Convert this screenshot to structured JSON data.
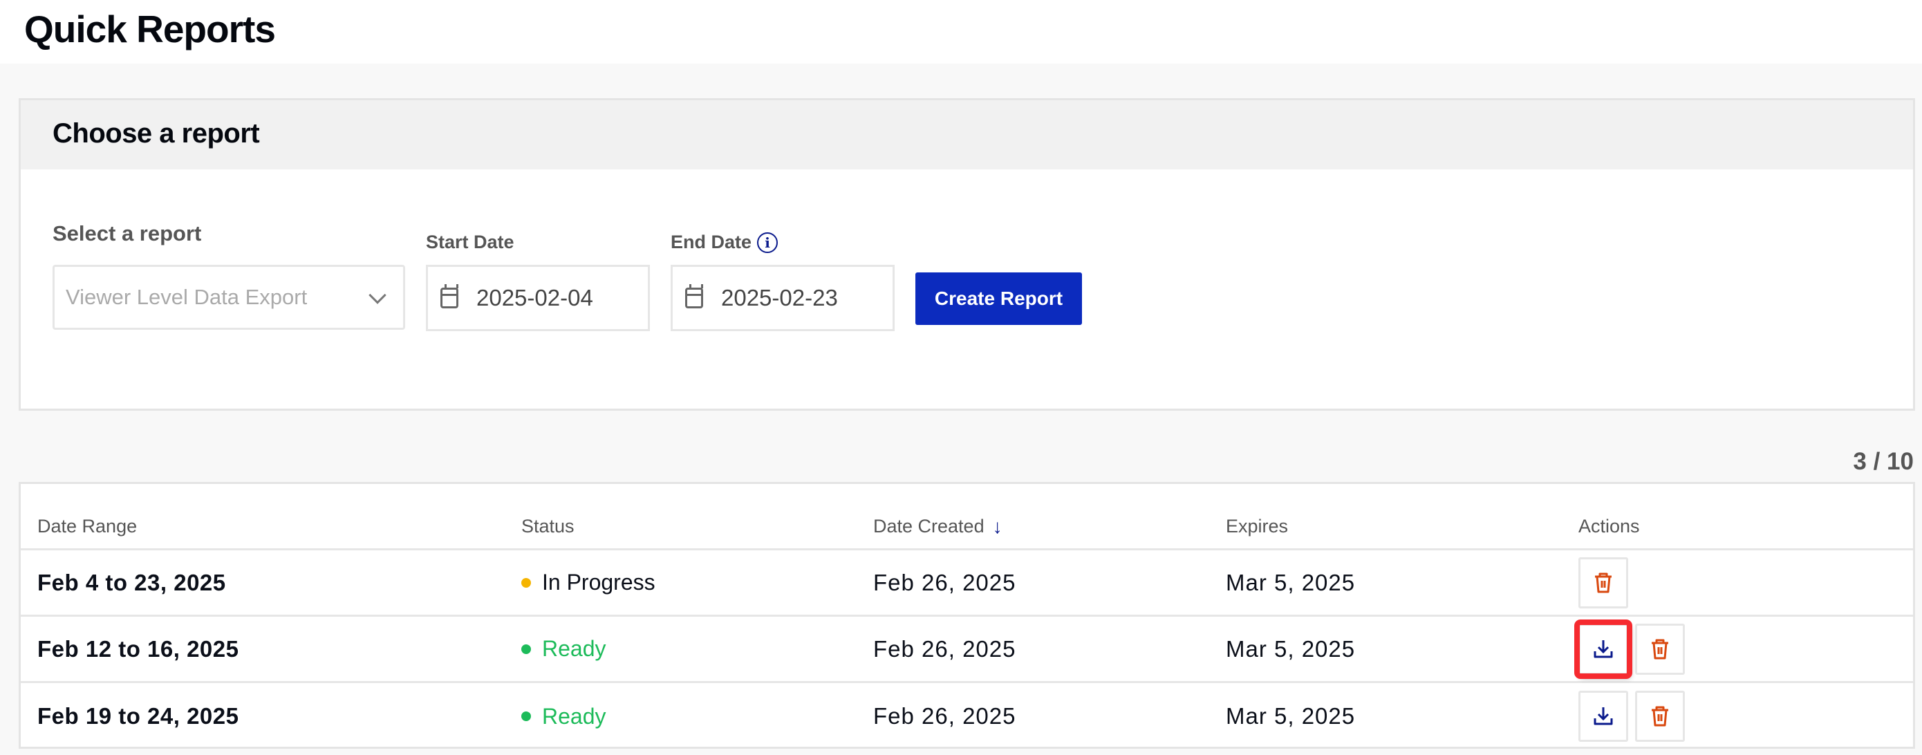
{
  "page": {
    "title": "Quick Reports"
  },
  "card": {
    "title": "Choose a report",
    "select_label": "Select a report",
    "select_value": "Viewer Level Data Export",
    "start_label": "Start Date",
    "start_value": "2025-02-04",
    "end_label": "End Date",
    "end_value": "2025-02-23",
    "create_label": "Create Report"
  },
  "pager": "3 / 10",
  "table": {
    "columns": [
      "Date Range",
      "Status",
      "Date Created",
      "Expires",
      "Actions"
    ],
    "rows": [
      {
        "range": "Feb 4 to 23, 2025",
        "status": "In Progress",
        "created": "Feb 26, 2025",
        "expires": "Mar 5, 2025",
        "actions": [
          "delete"
        ]
      },
      {
        "range": "Feb 12 to 16, 2025",
        "status": "Ready",
        "created": "Feb 26, 2025",
        "expires": "Mar 5, 2025",
        "actions": [
          "download",
          "delete"
        ]
      },
      {
        "range": "Feb 19 to 24, 2025",
        "status": "Ready",
        "created": "Feb 26, 2025",
        "expires": "Mar 5, 2025",
        "actions": [
          "download",
          "delete"
        ]
      }
    ]
  },
  "colors": {
    "accent": "#0c2bbe",
    "in_progress": "#f5b400",
    "ready": "#1dbb5a",
    "delete": "#d9480f",
    "download": "#0a1a8c",
    "highlight": "#f62a2f"
  },
  "icons": {
    "sort": "arrow-down-icon",
    "info": "info-icon",
    "calendar": "calendar-icon",
    "download": "download-icon",
    "delete": "trash-icon",
    "chevron": "chevron-down-icon"
  }
}
